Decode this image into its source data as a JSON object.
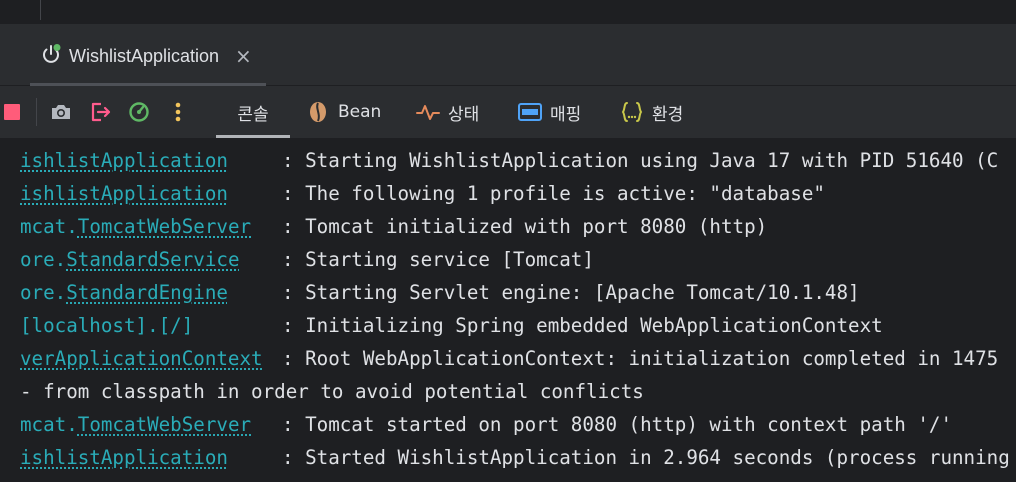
{
  "window": {
    "run_tab": {
      "label": "WishlistApplication",
      "close": "×"
    }
  },
  "colors": {
    "background": "#1e1f22",
    "panel": "#2b2d30",
    "logger_link": "#2aacb8",
    "stop_red": "#e06c75",
    "green_badge": "#5fb865",
    "exit_pink": "#ff5c8d",
    "warning_yellow": "#f2c55c"
  },
  "toolbar": {
    "icons": [
      "stop-icon",
      "camera-icon",
      "exit-icon",
      "profiler-icon",
      "more-vertical-icon"
    ],
    "tabs": [
      {
        "label": "콘솔",
        "icon": "",
        "active": true
      },
      {
        "label": "Bean",
        "icon": "bean-icon",
        "active": false
      },
      {
        "label": "상태",
        "icon": "health-pulse-icon",
        "active": false
      },
      {
        "label": "매핑",
        "icon": "api-icon",
        "active": false
      },
      {
        "label": "환경",
        "icon": "braces-icon",
        "active": false
      }
    ]
  },
  "console": {
    "lines": [
      {
        "pkg": "",
        "cls": "ishlistApplication",
        "msg": ": Starting WishlistApplication using Java 17 with PID 51640 (C"
      },
      {
        "pkg": "",
        "cls": "ishlistApplication",
        "msg": ": The following 1 profile is active: \"database\""
      },
      {
        "pkg": "mcat.",
        "cls": "TomcatWebServer",
        "msg": ": Tomcat initialized with port 8080 (http)"
      },
      {
        "pkg": "ore.",
        "cls": "StandardService",
        "msg": ": Starting service [Tomcat]"
      },
      {
        "pkg": "ore.",
        "cls": "StandardEngine",
        "msg": ": Starting Servlet engine: [Apache Tomcat/10.1.48]"
      },
      {
        "pkg": "[localhost].[/]",
        "cls": "",
        "msg": ": Initializing Spring embedded WebApplicationContext"
      },
      {
        "pkg": "",
        "cls": "verApplicationContext",
        "msg": ": Root WebApplicationContext: initialization completed in 1475"
      },
      {
        "full": "- from classpath in order to avoid potential conflicts"
      },
      {
        "pkg": "mcat.",
        "cls": "TomcatWebServer",
        "msg": ": Tomcat started on port 8080 (http) with context path '/'"
      },
      {
        "pkg": "",
        "cls": "ishlistApplication",
        "msg": ": Started WishlistApplication in 2.964 seconds (process running"
      }
    ]
  }
}
